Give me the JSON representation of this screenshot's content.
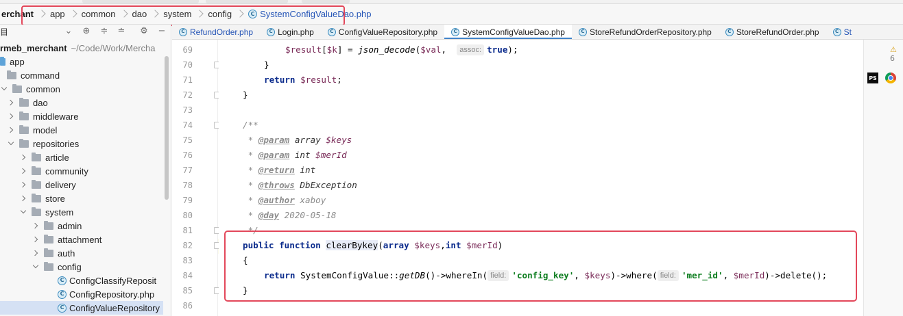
{
  "breadcrumb": {
    "items": [
      "erchant",
      "app",
      "common",
      "dao",
      "system",
      "config"
    ],
    "file": "SystemConfigValueDao.php",
    "file_icon": "C"
  },
  "project_panel": {
    "title": "目",
    "root": {
      "label": "rmeb_merchant",
      "path": "~/Code/Work/Mercha"
    },
    "tree": [
      {
        "label": "app",
        "icon": "folder-blue"
      },
      {
        "label": "command",
        "icon": "folder"
      },
      {
        "label": "common",
        "icon": "folder"
      },
      {
        "label": "dao",
        "icon": "folder"
      },
      {
        "label": "middleware",
        "icon": "folder"
      },
      {
        "label": "model",
        "icon": "folder"
      },
      {
        "label": "repositories",
        "icon": "folder"
      },
      {
        "label": "article",
        "icon": "folder"
      },
      {
        "label": "community",
        "icon": "folder"
      },
      {
        "label": "delivery",
        "icon": "folder"
      },
      {
        "label": "store",
        "icon": "folder"
      },
      {
        "label": "system",
        "icon": "folder"
      },
      {
        "label": "admin",
        "icon": "folder"
      },
      {
        "label": "attachment",
        "icon": "folder"
      },
      {
        "label": "auth",
        "icon": "folder"
      },
      {
        "label": "config",
        "icon": "folder"
      },
      {
        "label": "ConfigClassifyReposit",
        "icon": "php-class"
      },
      {
        "label": "ConfigRepository.php",
        "icon": "php-class"
      },
      {
        "label": "ConfigValueRepository",
        "icon": "php-class"
      }
    ]
  },
  "tabs": [
    {
      "label": "RefundOrder.php"
    },
    {
      "label": "Login.php"
    },
    {
      "label": "ConfigValueRepository.php"
    },
    {
      "label": "SystemConfigValueDao.php"
    },
    {
      "label": "StoreRefundOrderRepository.php"
    },
    {
      "label": "StoreRefundOrder.php"
    },
    {
      "label": "St"
    }
  ],
  "active_tab": "SystemConfigValueDao.php",
  "editor": {
    "line_numbers": [
      "69",
      "70",
      "71",
      "72",
      "73",
      "74",
      "75",
      "76",
      "77",
      "78",
      "79",
      "80",
      "81",
      "82",
      "83",
      "84",
      "85",
      "86"
    ],
    "current_line": "82",
    "tokens": {
      "l69_var1": "$result",
      "l69_br": "[",
      "l69_var2": "$k",
      "l69_rest1": "] = ",
      "l69_fn": "json_decode",
      "l69_p": "(",
      "l69_var3": "$val",
      "l69_c": ",  ",
      "l69_hint": "assoc:",
      "l69_true": "true",
      "l69_end": ");",
      "l70": "}",
      "l71_kw": "return",
      "l71_var": "$result",
      "l71_end": ";",
      "l72": "}",
      "l74": "/**",
      "l75_star": " * ",
      "l75_tag": "@param",
      "l75_type": " array ",
      "l75_var": "$keys",
      "l76_star": " * ",
      "l76_tag": "@param",
      "l76_type": " int ",
      "l76_var": "$merId",
      "l77_star": " * ",
      "l77_tag": "@return",
      "l77_type": " int",
      "l78_star": " * ",
      "l78_tag": "@throws",
      "l78_type": " DbException",
      "l79_star": " * ",
      "l79_tag": "@author",
      "l79_rest": " xaboy",
      "l80_star": " * ",
      "l80_tag": "@day",
      "l80_rest": " 2020-05-18",
      "l81": " */",
      "l82_kw1": "public",
      "l82_kw2": "function",
      "l82_fn": "clearBykey",
      "l82_p": "(",
      "l82_kw3": "array",
      "l82_var1": "$keys",
      "l82_c": ",",
      "l82_kw4": "int",
      "l82_var2": "$merId",
      "l82_end": ")",
      "l83": "{",
      "l84_kw": "return",
      "l84_cls": "SystemConfigValue",
      "l84_dc": "::",
      "l84_get": "getDB",
      "l84_m1": "()->whereIn(",
      "l84_hint1": "field:",
      "l84_str1": "'config_key'",
      "l84_c1": ", ",
      "l84_var1": "$keys",
      "l84_m2": ")->where(",
      "l84_hint2": "field:",
      "l84_str2": "'mer_id'",
      "l84_c2": ", ",
      "l84_var2": "$merId",
      "l84_m3": ")->delete();",
      "l85": "}"
    }
  },
  "right_strip": {
    "warning_count": "6"
  },
  "colors": {
    "highlight_box": "#e3475a",
    "accent": "#4083c9"
  }
}
